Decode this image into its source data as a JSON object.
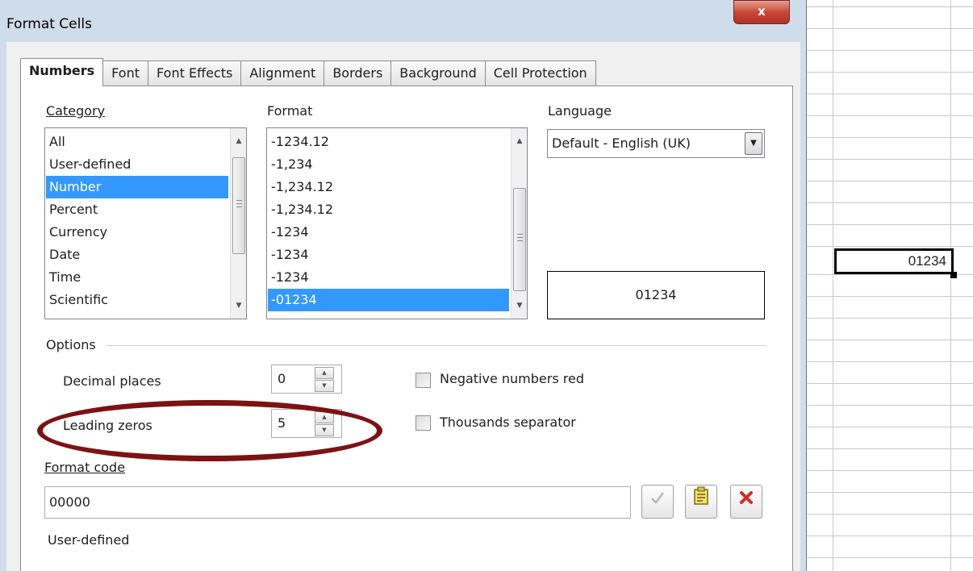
{
  "dialog": {
    "title": "Format Cells",
    "close_glyph": "x",
    "tabs": [
      {
        "label": "Numbers"
      },
      {
        "label": "Font"
      },
      {
        "label": "Font Effects"
      },
      {
        "label": "Alignment"
      },
      {
        "label": "Borders"
      },
      {
        "label": "Background"
      },
      {
        "label": "Cell Protection"
      }
    ],
    "active_tab": "Numbers"
  },
  "numbers": {
    "category": {
      "label": "Category",
      "items": [
        "All",
        "User-defined",
        "Number",
        "Percent",
        "Currency",
        "Date",
        "Time",
        "Scientific"
      ],
      "selected": "Number"
    },
    "format": {
      "label": "Format",
      "items": [
        "-1234.12",
        "-1,234",
        "-1,234.12",
        "-1,234.12",
        "-1234",
        "-1234",
        "-1234",
        "-01234"
      ],
      "selected": "-01234"
    },
    "language": {
      "label": "Language",
      "value": "Default - English (UK)"
    },
    "preview": "01234",
    "options": {
      "label": "Options",
      "decimal_places": {
        "label": "Decimal places",
        "value": "0"
      },
      "leading_zeros": {
        "label": "Leading zeros",
        "value": "5"
      },
      "negative_red": {
        "label": "Negative numbers red",
        "checked": false
      },
      "thousands_sep": {
        "label": "Thousands separator",
        "checked": false
      }
    },
    "format_code": {
      "label": "Format code",
      "value": "00000"
    },
    "status": "User-defined"
  },
  "spreadsheet": {
    "selected_cell_value": "01234"
  },
  "colors": {
    "highlight": "#7d1212",
    "selection": "#3399ff",
    "close_button": "#c8493a"
  },
  "icons": [
    "close-icon",
    "checkmark-icon",
    "comment-icon",
    "delete-icon",
    "scroll-up-arrow-icon",
    "scroll-down-arrow-icon",
    "dropdown-arrow-icon"
  ]
}
